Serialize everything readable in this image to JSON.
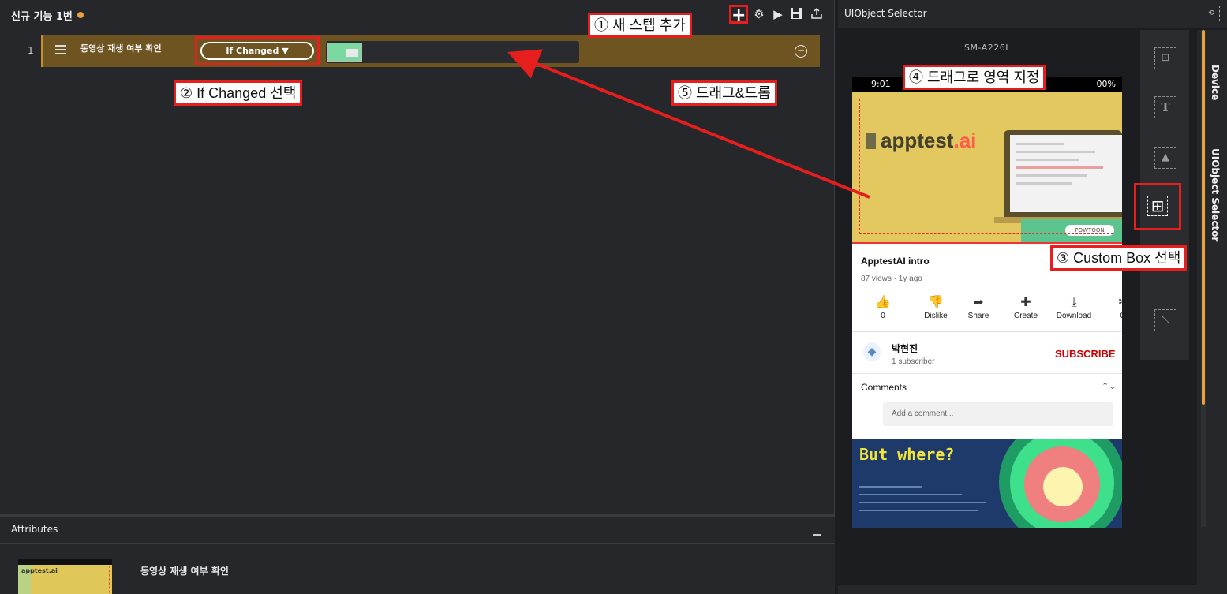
{
  "editor": {
    "tab_title": "신규 기능 1번",
    "step": {
      "index": "1",
      "name": "동영상 재생 여부 확인",
      "condition": "If Changed ▼"
    },
    "toolbar": {
      "add": "+",
      "settings": "⚙",
      "play": "▶",
      "save": "💾",
      "export": "⇪"
    }
  },
  "callouts": {
    "c1": "① 새 스텝 추가",
    "c2": "② If Changed 선택",
    "c3": "③ Custom Box 선택",
    "c4": "④ 드래그로 영역 지정",
    "c5": "⑤ 드래그&드롭"
  },
  "attributes": {
    "title": "Attributes",
    "step_name": "동영상 재생 여부 확인",
    "thumb_logo": "apptest.ai"
  },
  "selector": {
    "title": "UIObject Selector",
    "device_name": "SM-A226L",
    "tabs": {
      "device": "Device",
      "uiobject": "UIObject Selector"
    },
    "tools": {
      "element": "⊡",
      "text": "T",
      "image": "▲",
      "custom": "⊞",
      "crop": "⤡"
    }
  },
  "phone": {
    "clock": "9:01",
    "battery": "00%",
    "brand": "apptest",
    "brand_ai": ".ai",
    "powtoon": "POWTOON",
    "video_title": "ApptestAI intro",
    "views": "87 views · 1y ago",
    "actions": [
      {
        "icon": "👍",
        "label": "0"
      },
      {
        "icon": "👎",
        "label": "Dislike"
      },
      {
        "icon": "➦",
        "label": "Share"
      },
      {
        "icon": "✚",
        "label": "Create"
      },
      {
        "icon": "⤓",
        "label": "Download"
      },
      {
        "icon": "✂",
        "label": "Cl"
      }
    ],
    "channel_name": "박현진",
    "channel_subs": "1 subscriber",
    "subscribe": "SUBSCRIBE",
    "comments": "Comments",
    "comment_placeholder": "Add a comment...",
    "video2_title": "But where?"
  },
  "colors": {
    "accent": "#e9a23b",
    "callout_border": "#e61e1e",
    "step_bg": "#6e5420"
  }
}
